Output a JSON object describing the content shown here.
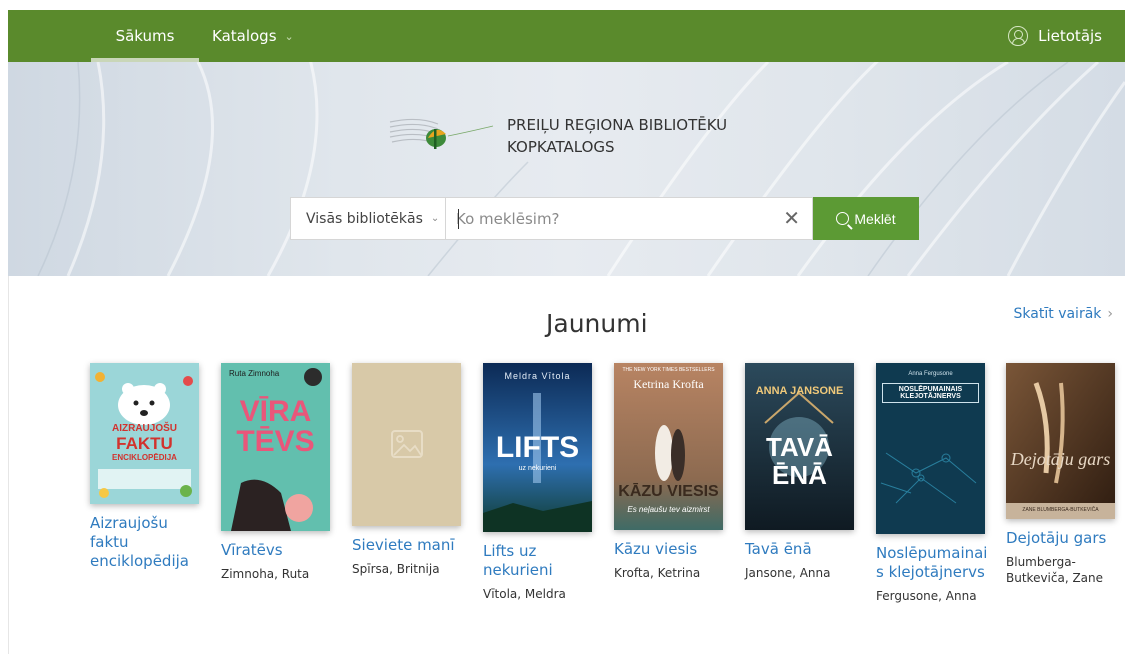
{
  "nav": {
    "home": "Sākums",
    "catalog": "Katalogs",
    "user": "Lietotājs"
  },
  "hero": {
    "title_line1": "PREIĻU REĢIONA BIBLIOTĒKU",
    "title_line2": "KOPKATALOGS",
    "library_select": "Visās bibliotēkās",
    "search_placeholder": "Ko meklēsim?",
    "search_button": "Meklēt"
  },
  "news": {
    "title": "Jaunumi",
    "see_more": "Skatīt vairāk",
    "books": [
      {
        "title": "Aizraujošu faktu enciklopēdija",
        "author": "",
        "cover_text": "AIZRAUJOŠU FAKTU ENCIKLOPĒDIJA"
      },
      {
        "title": "Vīratēvs",
        "author": "Zimnoha, Ruta",
        "cover_text": "VĪRA TĒVS",
        "cover_author": "Ruta Zimnoha"
      },
      {
        "title": "Sieviete manī",
        "author": "Spīrsa, Britnija",
        "cover_text": ""
      },
      {
        "title": "Lifts uz nekurieni",
        "author": "Vītola, Meldra",
        "cover_text": "LIFTS",
        "cover_author": "Meldra Vītola",
        "cover_sub": "uz nekurieni"
      },
      {
        "title": "Kāzu viesis",
        "author": "Krofta, Ketrina",
        "cover_text": "KĀZU VIESIS",
        "cover_author": "Ketrina Krofta",
        "cover_top": "THE NEW YORK TIMES BESTSELLERS",
        "cover_sub": "Es neļaušu tev aizmirst"
      },
      {
        "title": "Tavā ēnā",
        "author": "Jansone, Anna",
        "cover_text": "TAVĀ ĒNĀ",
        "cover_author": "ANNA JANSONE"
      },
      {
        "title": "Noslēpumainais klejotājnervs",
        "author": "Fergusone, Anna",
        "cover_text": "NOSLĒPUMAINAIS KLEJOTĀJNERVS",
        "cover_author": "Anna Fergusone"
      },
      {
        "title": "Dejotāju gars",
        "author": "Blumberga-Butkeviča, Zane",
        "cover_text": "Dejotāju gars",
        "cover_author": "ZANE BLUMBERGA-BUTKEVIČA"
      }
    ]
  },
  "colors": {
    "nav_green": "#5a8a2c",
    "button_green": "#5c9a34",
    "link_blue": "#2f7bbf"
  }
}
